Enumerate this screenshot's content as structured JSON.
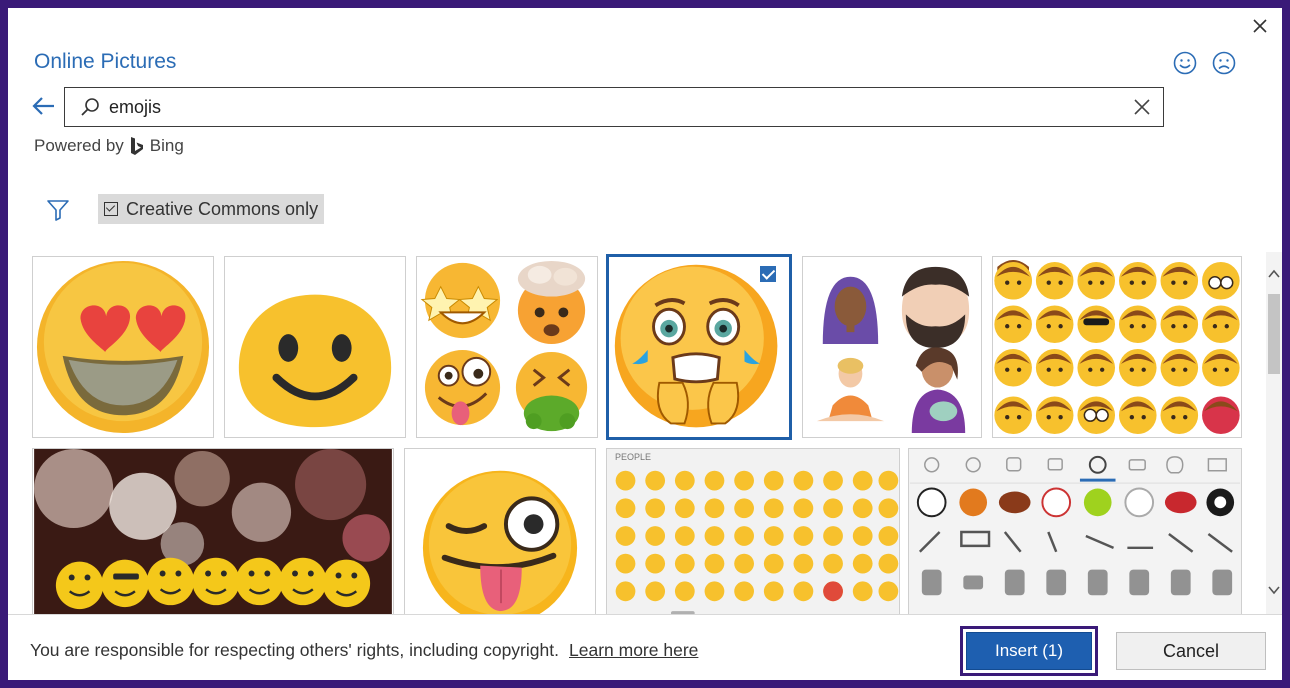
{
  "dialog": {
    "title": "Online Pictures",
    "close_icon": "close-icon",
    "feedback": {
      "smile_icon": "smile-icon",
      "frown_icon": "frown-icon"
    }
  },
  "search": {
    "value": "emojis",
    "back_icon": "back-arrow-icon",
    "search_icon": "search-icon",
    "clear_icon": "close-icon"
  },
  "powered_by": {
    "label": "Powered by",
    "brand": "Bing",
    "brand_icon": "bing-logo-icon"
  },
  "filters": {
    "filter_icon": "filter-icon",
    "creative_commons_label": "Creative Commons only",
    "creative_commons_checked": true
  },
  "results": {
    "items": [
      {
        "description": "heart-eyes-emoji",
        "selected": false
      },
      {
        "description": "smile-emoji",
        "selected": false
      },
      {
        "description": "star-struck-emoji-set",
        "selected": false
      },
      {
        "description": "fearful-crying-emoji",
        "selected": true
      },
      {
        "description": "people-emoji-set",
        "selected": false
      },
      {
        "description": "face-emoji-grid",
        "selected": false
      },
      {
        "description": "bokeh-emoji-balls",
        "selected": false
      },
      {
        "description": "winking-tongue-emoji",
        "selected": false
      },
      {
        "description": "keyboard-people-panel",
        "selected": false
      },
      {
        "description": "keyboard-sports-panel",
        "selected": false
      }
    ],
    "keyboard_section_label": "PEOPLE"
  },
  "footer": {
    "notice": "You are responsible for respecting others' rights, including copyright.",
    "learn_more": "Learn more here",
    "insert_label": "Insert (1)",
    "cancel_label": "Cancel"
  },
  "colors": {
    "accent": "#2b6cb5",
    "frame": "#3a1a78",
    "emoji_yellow": "#f7c12d"
  }
}
